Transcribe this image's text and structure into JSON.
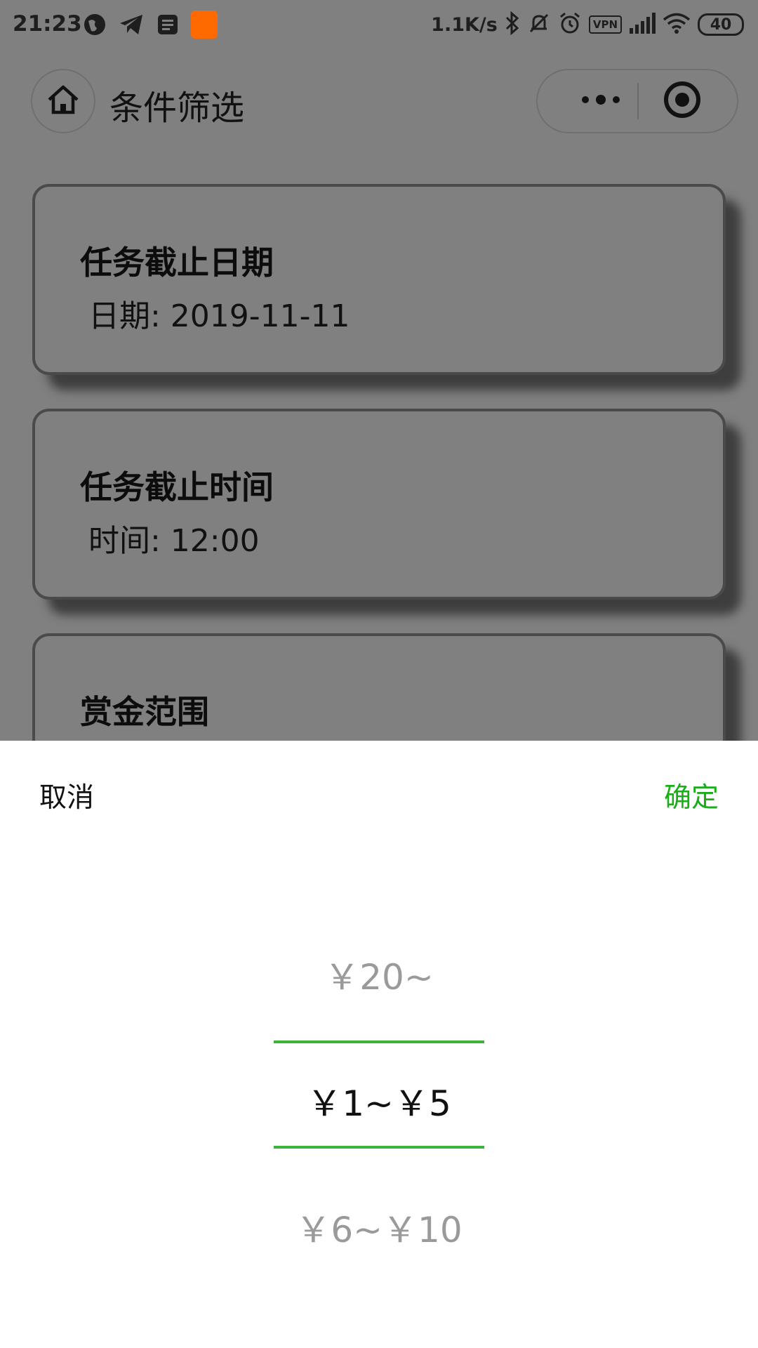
{
  "status_bar": {
    "time": "21:23",
    "left_icons": [
      "globe-icon",
      "telegram-icon",
      "news-icon",
      "orange-app-icon"
    ],
    "network_speed": "1.1K/s",
    "right_icons": [
      "bluetooth-icon",
      "mute-icon",
      "alarm-icon",
      "vpn-icon",
      "signal-icon",
      "wifi-icon",
      "battery-icon"
    ],
    "vpn_label": "VPN",
    "battery": "40"
  },
  "nav": {
    "home_icon": "home-icon",
    "title": "条件筛选",
    "more_icon": "more-dots-icon",
    "close_icon": "target-icon"
  },
  "cards": [
    {
      "title": "任务截止日期",
      "value": "日期: 2019-11-11"
    },
    {
      "title": "任务截止时间",
      "value": "时间: 12:00"
    },
    {
      "title": "赏金范围"
    }
  ],
  "picker": {
    "cancel_label": "取消",
    "confirm_label": "确定",
    "confirm_color": "#1aad19",
    "options_visible": [
      "￥20~",
      "￥1~￥5",
      "￥6~￥10"
    ],
    "selected": "￥1~￥5"
  }
}
